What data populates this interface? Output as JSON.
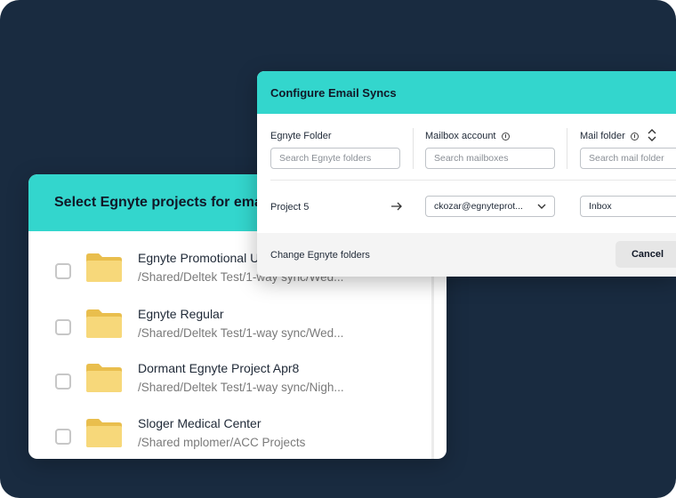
{
  "select_panel": {
    "title": "Select Egnyte projects for email syncs",
    "projects": [
      {
        "name": "Egnyte Promotional Updates",
        "path": "/Shared/Deltek Test/1-way sync/Wed...",
        "checked": false
      },
      {
        "name": "Egnyte Regular",
        "path": "/Shared/Deltek Test/1-way sync/Wed...",
        "checked": false
      },
      {
        "name": "Dormant Egnyte Project Apr8",
        "path": "/Shared/Deltek Test/1-way sync/Nigh...",
        "checked": false
      },
      {
        "name": "Sloger Medical Center",
        "path": "/Shared mplomer/ACC Projects",
        "checked": false
      }
    ]
  },
  "config_panel": {
    "title": "Configure Email Syncs",
    "columns": {
      "egnyte_folder_label": "Egnyte Folder",
      "mailbox_label": "Mailbox account",
      "mail_folder_label": "Mail folder"
    },
    "search": {
      "egnyte_placeholder": "Search Egnyte folders",
      "mailbox_placeholder": "Search mailboxes",
      "mail_folder_placeholder": "Search mail folder"
    },
    "row": {
      "project": "Project 5",
      "mailbox_value": "ckozar@egnyteprot...",
      "mail_folder_value": "Inbox"
    },
    "footer": {
      "change_link": "Change Egnyte folders",
      "cancel_label": "Cancel"
    }
  },
  "colors": {
    "background": "#192b40",
    "accent_teal": "#33d6cd",
    "folder_yellow": "#f7d87a"
  },
  "icons": [
    "folder-icon",
    "info-icon",
    "sort-icon",
    "arrow-right-icon",
    "chevron-down-icon"
  ]
}
